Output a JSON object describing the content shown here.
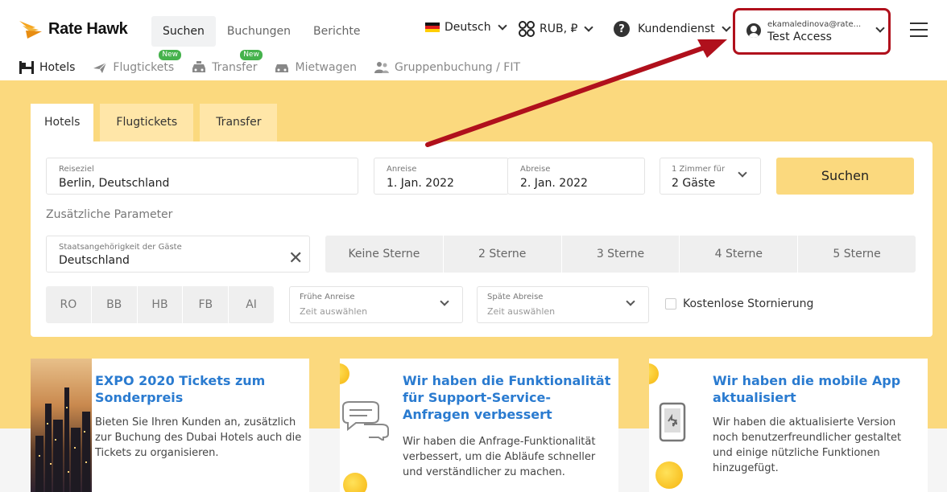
{
  "brand": {
    "name": "Rate Hawk"
  },
  "header": {
    "nav": [
      "Suchen",
      "Buchungen",
      "Berichte"
    ],
    "language": "Deutsch",
    "currency": "RUB, ₽",
    "support": "Kundendienst",
    "account": {
      "email": "ekamaledinova@rate...",
      "name": "Test Access"
    }
  },
  "product_nav": {
    "items": [
      {
        "label": "Hotels",
        "icon": "hotel-icon"
      },
      {
        "label": "Flugtickets",
        "icon": "plane-icon",
        "badge": "New"
      },
      {
        "label": "Transfer",
        "icon": "taxi-icon",
        "badge": "New"
      },
      {
        "label": "Mietwagen",
        "icon": "car-icon"
      },
      {
        "label": "Gruppenbuchung / FIT",
        "icon": "group-icon"
      }
    ]
  },
  "search": {
    "tabs": [
      "Hotels",
      "Flugtickets",
      "Transfer"
    ],
    "destination": {
      "label": "Reiseziel",
      "value": "Berlin, Deutschland"
    },
    "checkin": {
      "label": "Anreise",
      "value": "1. Jan. 2022"
    },
    "checkout": {
      "label": "Abreise",
      "value": "2. Jan. 2022"
    },
    "guests": {
      "label": "1 Zimmer für",
      "value": "2 Gäste"
    },
    "submit": "Suchen",
    "extra_params": "Zusätzliche Parameter",
    "citizenship": {
      "label": "Staatsangehörigkeit der Gäste",
      "value": "Deutschland"
    },
    "stars": [
      "Keine Sterne",
      "2 Sterne",
      "3 Sterne",
      "4 Sterne",
      "5 Sterne"
    ],
    "meals": [
      "RO",
      "BB",
      "HB",
      "FB",
      "AI"
    ],
    "early_checkin": {
      "label": "Frühe Anreise",
      "placeholder": "Zeit auswählen"
    },
    "late_checkout": {
      "label": "Späte Abreise",
      "placeholder": "Zeit auswählen"
    },
    "free_cancellation": "Kostenlose Stornierung"
  },
  "news": [
    {
      "title": "EXPO 2020 Tickets zum Sonderpreis",
      "body": "Bieten Sie Ihren Kunden an, zusätzlich zur Buchung des Dubai Hotels auch die Tickets zu organisieren."
    },
    {
      "title": "Wir haben die Funktionalität für Support-Service-Anfragen verbessert",
      "body": "Wir haben die Anfrage-Funktionalität verbessert, um die Abläufe schneller und verständlicher zu machen."
    },
    {
      "title": "Wir haben die mobile App aktualisiert",
      "body": "Wir haben die aktualisierte Version noch benutzerfreundlicher gestaltet und einige nützliche Funktionen hinzugefügt."
    }
  ],
  "colors": {
    "accent_yellow": "#fbd97e",
    "link_blue": "#2a7bd0",
    "annotation_red": "#b0101c",
    "badge_green": "#45b24c"
  }
}
